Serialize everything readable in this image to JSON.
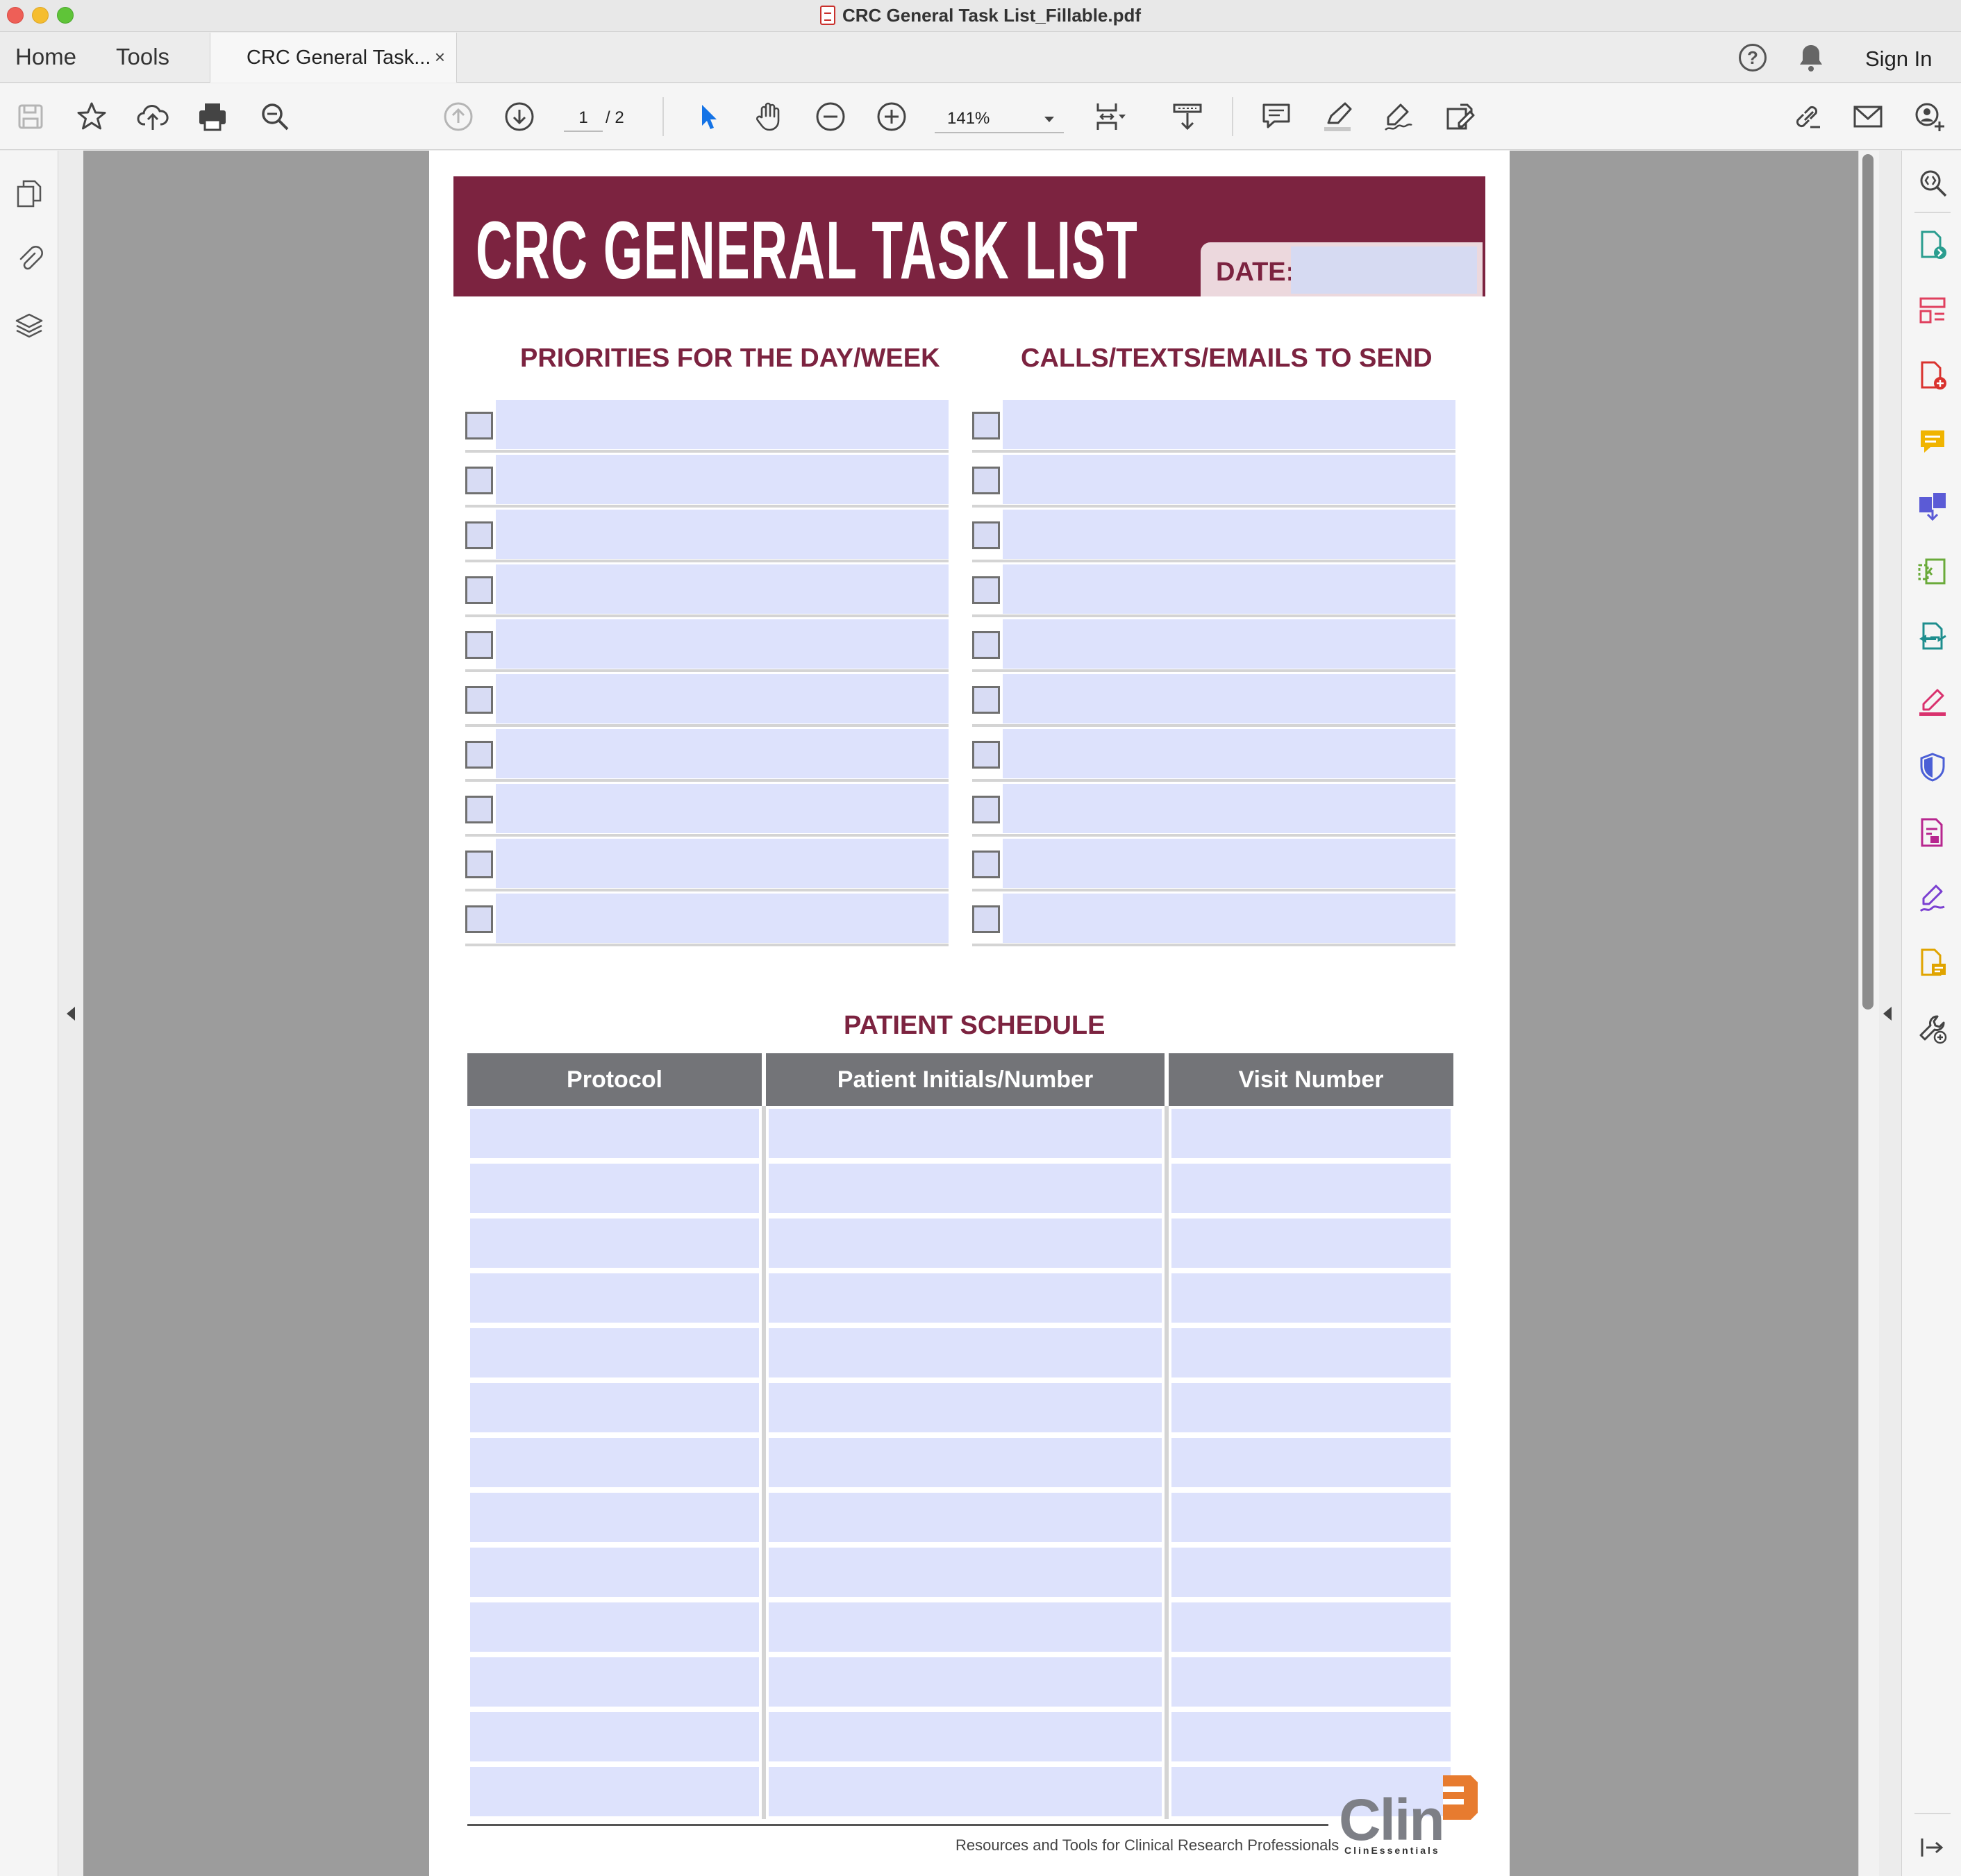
{
  "window": {
    "title": "CRC General Task List_Fillable.pdf"
  },
  "tabs": {
    "home": "Home",
    "tools": "Tools",
    "document": "CRC General Task...",
    "close": "×"
  },
  "header": {
    "help": "?",
    "sign_in": "Sign In"
  },
  "toolbar": {
    "page_current": "1",
    "page_total": "/ 2",
    "zoom": "141%"
  },
  "document": {
    "title": "CRC GENERAL TASK LIST",
    "date_label": "DATE:",
    "date_value": "",
    "priorities_heading": "PRIORITIES FOR THE DAY/WEEK",
    "calls_heading": "CALLS/TEXTS/EMAILS TO SEND",
    "task_rows": 10,
    "schedule_heading": "PATIENT SCHEDULE",
    "schedule_columns": [
      "Protocol",
      "Patient Initials/Number",
      "Visit Number"
    ],
    "schedule_rows": 13,
    "footer_text": "Resources and Tools for Clinical Research Professionals",
    "logo_text": "Clin",
    "logo_subtext": "ClinEssentials"
  },
  "colors": {
    "brand_maroon": "#7c2340",
    "field_fill": "#dde2fc",
    "header_gray": "#737478",
    "logo_orange": "#e77b2f"
  },
  "icons": {
    "toolbar": [
      "save-icon",
      "bookmark-star-icon",
      "upload-cloud-icon",
      "print-icon",
      "search-zoom-icon",
      "page-up-icon",
      "page-down-icon",
      "select-arrow-icon",
      "hand-tool-icon",
      "zoom-out-icon",
      "zoom-in-icon",
      "fit-page-icon",
      "scroll-mode-icon",
      "comment-icon",
      "highlight-icon",
      "sign-icon",
      "edit-pdf-icon",
      "share-link-icon",
      "email-icon",
      "add-user-icon"
    ],
    "left_panel": [
      "pages-icon",
      "attachment-icon",
      "layers-icon"
    ],
    "right_panel": [
      "zoom-search-icon",
      "export-pdf-icon",
      "organize-pages-icon",
      "create-pdf-icon",
      "comment-tool-icon",
      "combine-files-icon",
      "compress-icon",
      "send-for-review-icon",
      "fill-sign-icon",
      "protect-icon",
      "redact-icon",
      "request-signature-icon",
      "scan-ocr-icon",
      "more-tools-icon",
      "collapse-panel-icon"
    ]
  }
}
